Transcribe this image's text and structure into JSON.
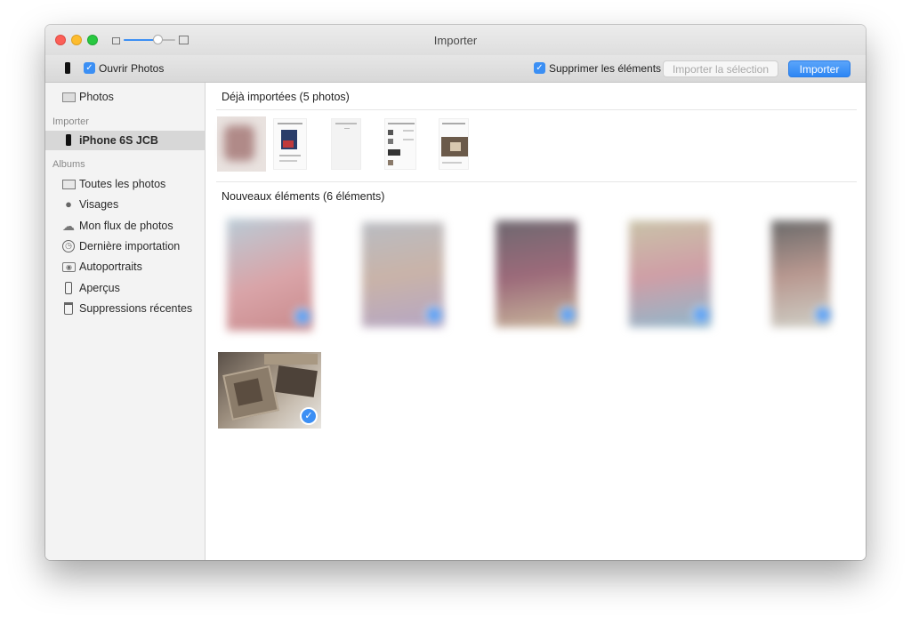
{
  "window": {
    "title": "Importer"
  },
  "toolbar": {
    "open_photos_label": "Ouvrir Photos",
    "delete_items_label": "Supprimer les éléments",
    "import_selection_label": "Importer la sélection",
    "import_label": "Importer"
  },
  "sidebar": {
    "photos_label": "Photos",
    "import_heading": "Importer",
    "device_label": "iPhone 6S JCB",
    "albums_heading": "Albums",
    "albums": [
      {
        "label": "Toutes les photos",
        "icon": "photos-stack-icon"
      },
      {
        "label": "Visages",
        "icon": "person-icon"
      },
      {
        "label": "Mon flux de photos",
        "icon": "cloud-icon"
      },
      {
        "label": "Dernière importation",
        "icon": "clock-icon"
      },
      {
        "label": "Autoportraits",
        "icon": "camera-icon"
      },
      {
        "label": "Aperçus",
        "icon": "phone-icon"
      },
      {
        "label": "Suppressions récentes",
        "icon": "trash-icon"
      }
    ]
  },
  "main": {
    "already_imported_title": "Déjà importées (5 photos)",
    "new_items_title": "Nouveaux éléments (6 éléments)"
  },
  "colors": {
    "accent": "#3c8ff4",
    "close": "#fc5f57",
    "minimize": "#fdbc2e",
    "zoom": "#28c840"
  },
  "zoom_slider": {
    "level": 0.65
  }
}
